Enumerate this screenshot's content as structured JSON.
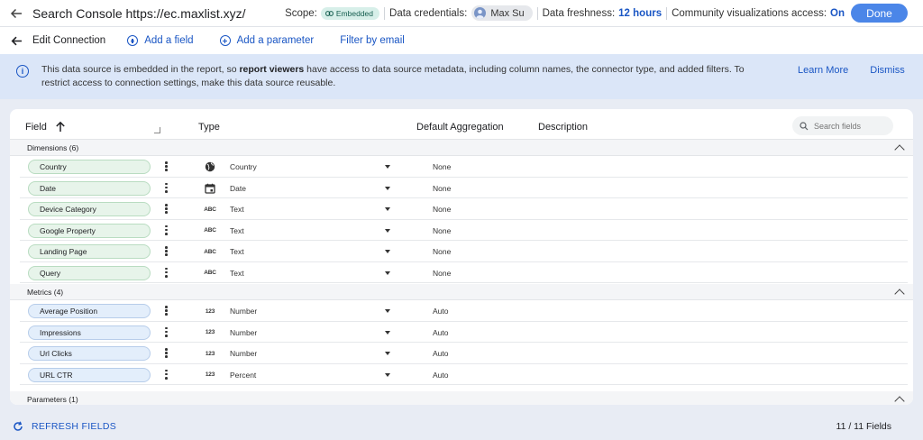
{
  "topbar": {
    "title": "Search Console https://ec.maxlist.xyz/",
    "scope_label": "Scope:",
    "scope_value": "Embedded",
    "credentials_label": "Data credentials:",
    "credentials_user": "Max Su",
    "freshness_label": "Data freshness:",
    "freshness_value": "12 hours",
    "community_label": "Community visualizations access:",
    "community_value": "On",
    "done_label": "Done"
  },
  "subbar": {
    "edit_label": "Edit Connection",
    "add_field": "Add a field",
    "add_parameter": "Add a parameter",
    "filter_email": "Filter by email"
  },
  "banner": {
    "msg_pre": "This data source is embedded in the report, so ",
    "msg_bold": "report viewers",
    "msg_post": " have access to data source metadata, including column names, the connector type, and added filters. To restrict access to connection settings, make this data source reusable.",
    "learn_more": "Learn More",
    "dismiss": "Dismiss"
  },
  "table": {
    "headers": {
      "field": "Field",
      "type": "Type",
      "aggregation": "Default Aggregation",
      "description": "Description"
    },
    "search_placeholder": "Search fields",
    "dimensions_label": "Dimensions (6)",
    "metrics_label": "Metrics (4)",
    "parameters_label": "Parameters (1)",
    "dimensions": [
      {
        "name": "Country",
        "type": "Country",
        "icon": "globe-icon",
        "agg": "None"
      },
      {
        "name": "Date",
        "type": "Date",
        "icon": "calendar-icon",
        "agg": "None"
      },
      {
        "name": "Device Category",
        "type": "Text",
        "icon": "text-type-icon",
        "agg": "None"
      },
      {
        "name": "Google Property",
        "type": "Text",
        "icon": "text-type-icon",
        "agg": "None"
      },
      {
        "name": "Landing Page",
        "type": "Text",
        "icon": "text-type-icon",
        "agg": "None"
      },
      {
        "name": "Query",
        "type": "Text",
        "icon": "text-type-icon",
        "agg": "None"
      }
    ],
    "metrics": [
      {
        "name": "Average Position",
        "type": "Number",
        "icon": "number-type-icon",
        "agg": "Auto"
      },
      {
        "name": "Impressions",
        "type": "Number",
        "icon": "number-type-icon",
        "agg": "Auto"
      },
      {
        "name": "Url Clicks",
        "type": "Number",
        "icon": "number-type-icon",
        "agg": "Auto"
      },
      {
        "name": "URL CTR",
        "type": "Percent",
        "icon": "number-type-icon",
        "agg": "Auto"
      }
    ],
    "abc_glyph": "ABC",
    "num_glyph": "123"
  },
  "footer": {
    "refresh_label": "REFRESH FIELDS",
    "count": "11 / 11 Fields"
  }
}
